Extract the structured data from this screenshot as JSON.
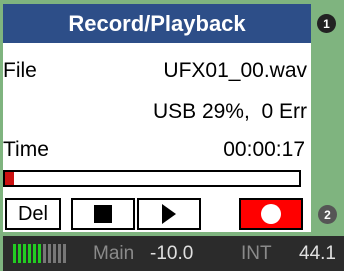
{
  "header": {
    "title": "Record/Playback",
    "badge": "1"
  },
  "fields": {
    "file_label": "File",
    "file_value": "UFX01_00.wav",
    "usb_status": "USB 29%,  0 Err",
    "time_label": "Time",
    "time_value": "00:00:17"
  },
  "progress": {
    "fraction": 0.03,
    "color": "#cc1111"
  },
  "toolbar": {
    "del_label": "Del",
    "stop_icon": "stop-icon",
    "play_icon": "play-icon",
    "record_icon": "record-icon",
    "badge": "2"
  },
  "status": {
    "meter_on": 6,
    "meter_off": 5,
    "main_label": "Main",
    "level": "-10.0",
    "int_label": "INT",
    "rate": "44.1"
  },
  "colors": {
    "header_bg": "#2d4e88",
    "frame_green": "#7fb47f",
    "record_red": "#ff0000",
    "meter_green": "#22cc22"
  }
}
